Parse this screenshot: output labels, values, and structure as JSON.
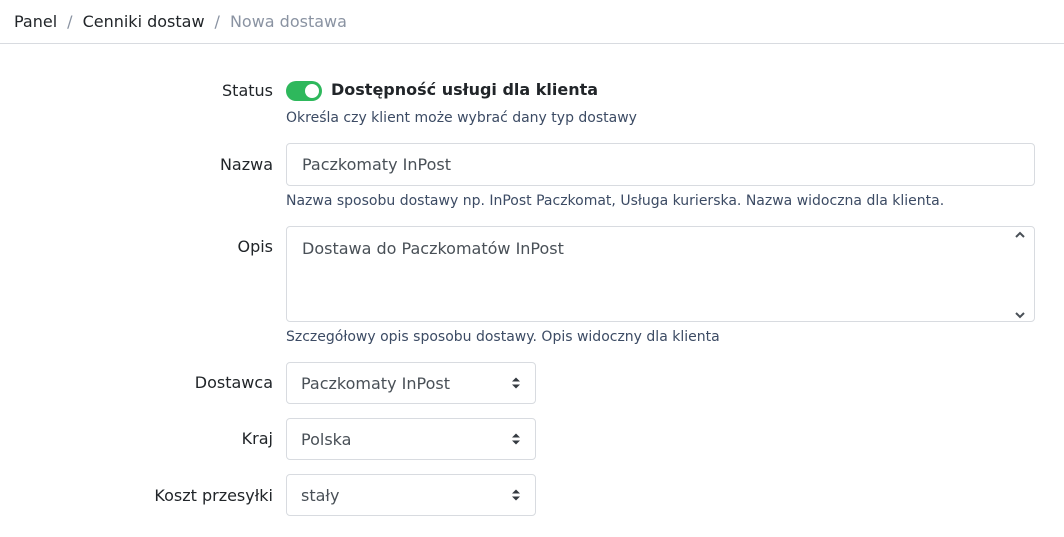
{
  "breadcrumb": {
    "items": [
      "Panel",
      "Cenniki dostaw"
    ],
    "separator": "/",
    "current": "Nowa dostawa"
  },
  "form": {
    "status": {
      "label": "Status",
      "toggle_label": "Dostępność usługi dla klienta",
      "toggle_on": true,
      "help": "Określa czy klient może wybrać dany typ dostawy",
      "accent": "#2eb85c"
    },
    "nazwa": {
      "label": "Nazwa",
      "value": "Paczkomaty InPost",
      "help": "Nazwa sposobu dostawy np. InPost Paczkomat, Usługa kurierska. Nazwa widoczna dla klienta."
    },
    "opis": {
      "label": "Opis",
      "value": "Dostawa do Paczkomatów InPost",
      "help": "Szczegółowy opis sposobu dostawy. Opis widoczny dla klienta"
    },
    "dostawca": {
      "label": "Dostawca",
      "value": "Paczkomaty InPost"
    },
    "kraj": {
      "label": "Kraj",
      "value": "Polska"
    },
    "koszt": {
      "label": "Koszt przesyłki",
      "value": "stały"
    }
  }
}
